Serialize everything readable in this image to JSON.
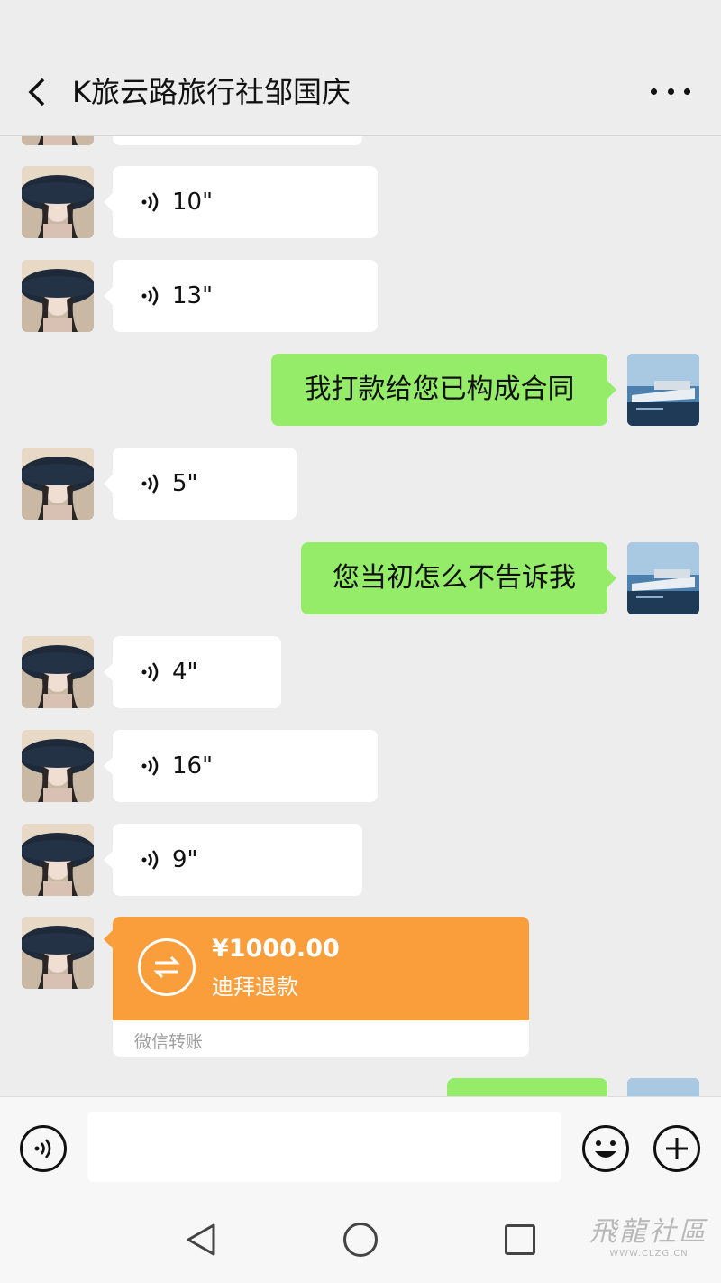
{
  "header": {
    "title": "K旅云路旅行社邹国庆"
  },
  "messages": {
    "v1": "10\"",
    "v2": "13\"",
    "t1": "我打款给您已构成合同",
    "v3": "5\"",
    "t2": "您当初怎么不告诉我",
    "v4": "4\"",
    "v5": "16\"",
    "v6": "9\""
  },
  "transfer": {
    "amount": "¥1000.00",
    "note": "迪拜退款",
    "footer": "微信转账"
  },
  "watermark": {
    "name": "飛龍社區",
    "url": "WWW.CLZG.CN"
  },
  "colors": {
    "green_bubble": "#95ec69",
    "transfer_orange": "#fa9d3b",
    "background": "#ededed"
  }
}
